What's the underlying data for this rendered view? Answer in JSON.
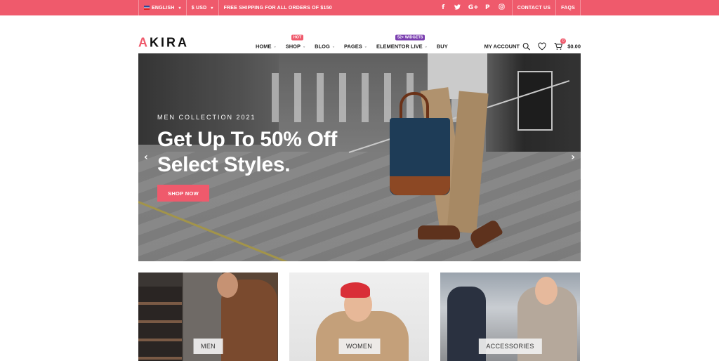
{
  "topbar": {
    "language": "ENGLISH",
    "currency": "$ USD",
    "shipping": "FREE SHIPPING FOR ALL ORDERS OF $150",
    "social": [
      {
        "icon": "facebook-icon",
        "glyph": "f"
      },
      {
        "icon": "twitter-icon",
        "glyph": "t"
      },
      {
        "icon": "google-plus-icon",
        "glyph": "G+"
      },
      {
        "icon": "pinterest-icon",
        "glyph": "P"
      },
      {
        "icon": "instagram-icon",
        "glyph": "◎"
      }
    ],
    "contact": "CONTACT US",
    "faqs": "FAQS"
  },
  "header": {
    "logo_a": "A",
    "logo_rest": "KIRA",
    "nav": [
      {
        "label": "HOME"
      },
      {
        "label": "SHOP",
        "badge": "HOT"
      },
      {
        "label": "BLOG"
      },
      {
        "label": "PAGES"
      },
      {
        "label": "ELEMENTOR LIVE",
        "badge": "52+ WIDGETS"
      },
      {
        "label": "BUY"
      }
    ],
    "account": "MY ACCOUNT",
    "cart_count": "0",
    "cart_total": "$0.00"
  },
  "hero": {
    "subtitle": "MEN COLLECTION 2021",
    "title_line1": "Get Up To 50% Off",
    "title_line2": "Select Styles.",
    "button": "SHOP NOW"
  },
  "categories": [
    {
      "label": "MEN"
    },
    {
      "label": "WOMEN"
    },
    {
      "label": "ACCESSORIES"
    }
  ],
  "colors": {
    "accent": "#ef5a6c",
    "widgets_badge": "#7b3fb0"
  }
}
